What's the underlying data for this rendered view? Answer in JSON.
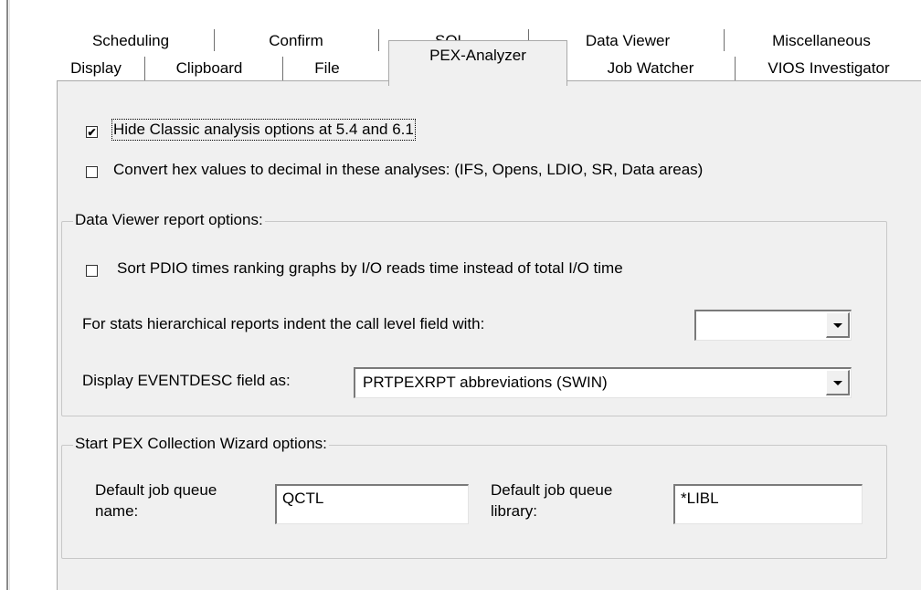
{
  "tabs_row_top": [
    "Scheduling",
    "Confirm",
    "SQL",
    "Data Viewer",
    "Miscellaneous"
  ],
  "tabs_row_bottom": [
    "Display",
    "Clipboard",
    "File",
    "PEX-Analyzer",
    "Job Watcher",
    "VIOS Investigator"
  ],
  "selected_tab": "PEX-Analyzer",
  "options": {
    "hide_classic": {
      "label": "Hide Classic analysis options at 5.4 and 6.1",
      "checked": true
    },
    "convert_hex": {
      "label": "Convert hex values to decimal in these analyses: (IFS, Opens, LDIO, SR, Data areas)",
      "checked": false
    }
  },
  "data_viewer": {
    "title": "Data Viewer report options:",
    "sort_pdio": {
      "label": "Sort PDIO times ranking graphs by I/O reads time instead of total I/O time",
      "checked": false
    },
    "indent_label": "For stats hierarchical reports indent the call level field with:",
    "indent_value": "",
    "eventdesc_label": "Display EVENTDESC field as:",
    "eventdesc_value": "PRTPEXRPT abbreviations (SWIN)"
  },
  "wizard": {
    "title": "Start PEX Collection Wizard options:",
    "queue_name_label_1": "Default job queue",
    "queue_name_label_2": "name:",
    "queue_name_value": "QCTL",
    "queue_lib_label_1": "Default job queue",
    "queue_lib_label_2": "library:",
    "queue_lib_value": "*LIBL"
  },
  "checkmark": "✔"
}
